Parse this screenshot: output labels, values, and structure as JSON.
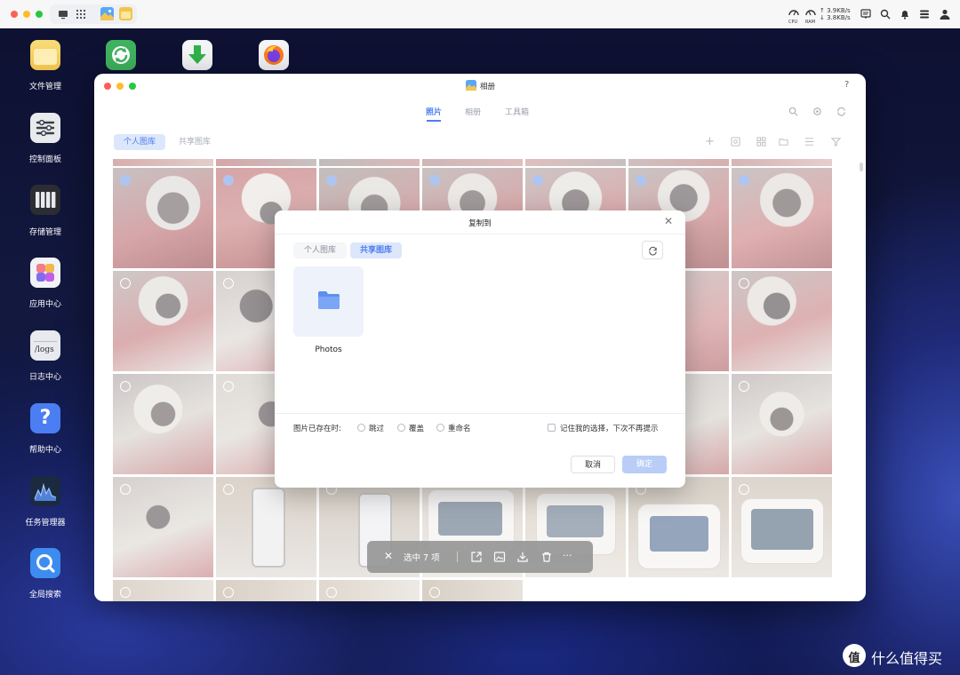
{
  "topbar": {
    "net_up": "↑ 3.9KB/s",
    "net_down": "↓ 3.8KB/s",
    "cpu_label": "CPU",
    "ram_label": "RAM"
  },
  "desktop": {
    "icons": [
      {
        "label": "文件管理",
        "icon": "folder-icon"
      },
      {
        "label": "控制面板",
        "icon": "control-panel-icon"
      },
      {
        "label": "存储管理",
        "icon": "storage-icon"
      },
      {
        "label": "应用中心",
        "icon": "app-center-icon"
      },
      {
        "label": "日志中心",
        "icon": "logs-icon",
        "icon_text": "/logs"
      },
      {
        "label": "帮助中心",
        "icon": "help-icon"
      },
      {
        "label": "任务管理器",
        "icon": "task-manager-icon"
      },
      {
        "label": "全局搜索",
        "icon": "search-icon"
      }
    ],
    "top_apps": [
      "sync-icon",
      "download-icon",
      "firefox-icon"
    ]
  },
  "window": {
    "title": "相册",
    "help": "?",
    "tabs": [
      "照片",
      "相册",
      "工具箱"
    ],
    "active_tab": "照片",
    "library_chips": [
      "个人图库",
      "共享图库"
    ]
  },
  "modal": {
    "title": "复制到",
    "tabs": [
      "个人图库",
      "共享图库"
    ],
    "active_tab": "共享图库",
    "folder_name": "Photos",
    "exists_label": "图片已存在时:",
    "options": [
      "跳过",
      "覆盖",
      "重命名"
    ],
    "remember_label": "记住我的选择，下次不再提示",
    "cancel": "取消",
    "confirm": "确定"
  },
  "action_bar": {
    "selected_text": "选中 7 项",
    "more": "···"
  },
  "watermark": {
    "text": "什么值得买",
    "logo": "值"
  },
  "colors": {
    "accent": "#4f7ef0",
    "selected_check": "#6d96e6",
    "chip_active_bg": "#dde7fb"
  }
}
